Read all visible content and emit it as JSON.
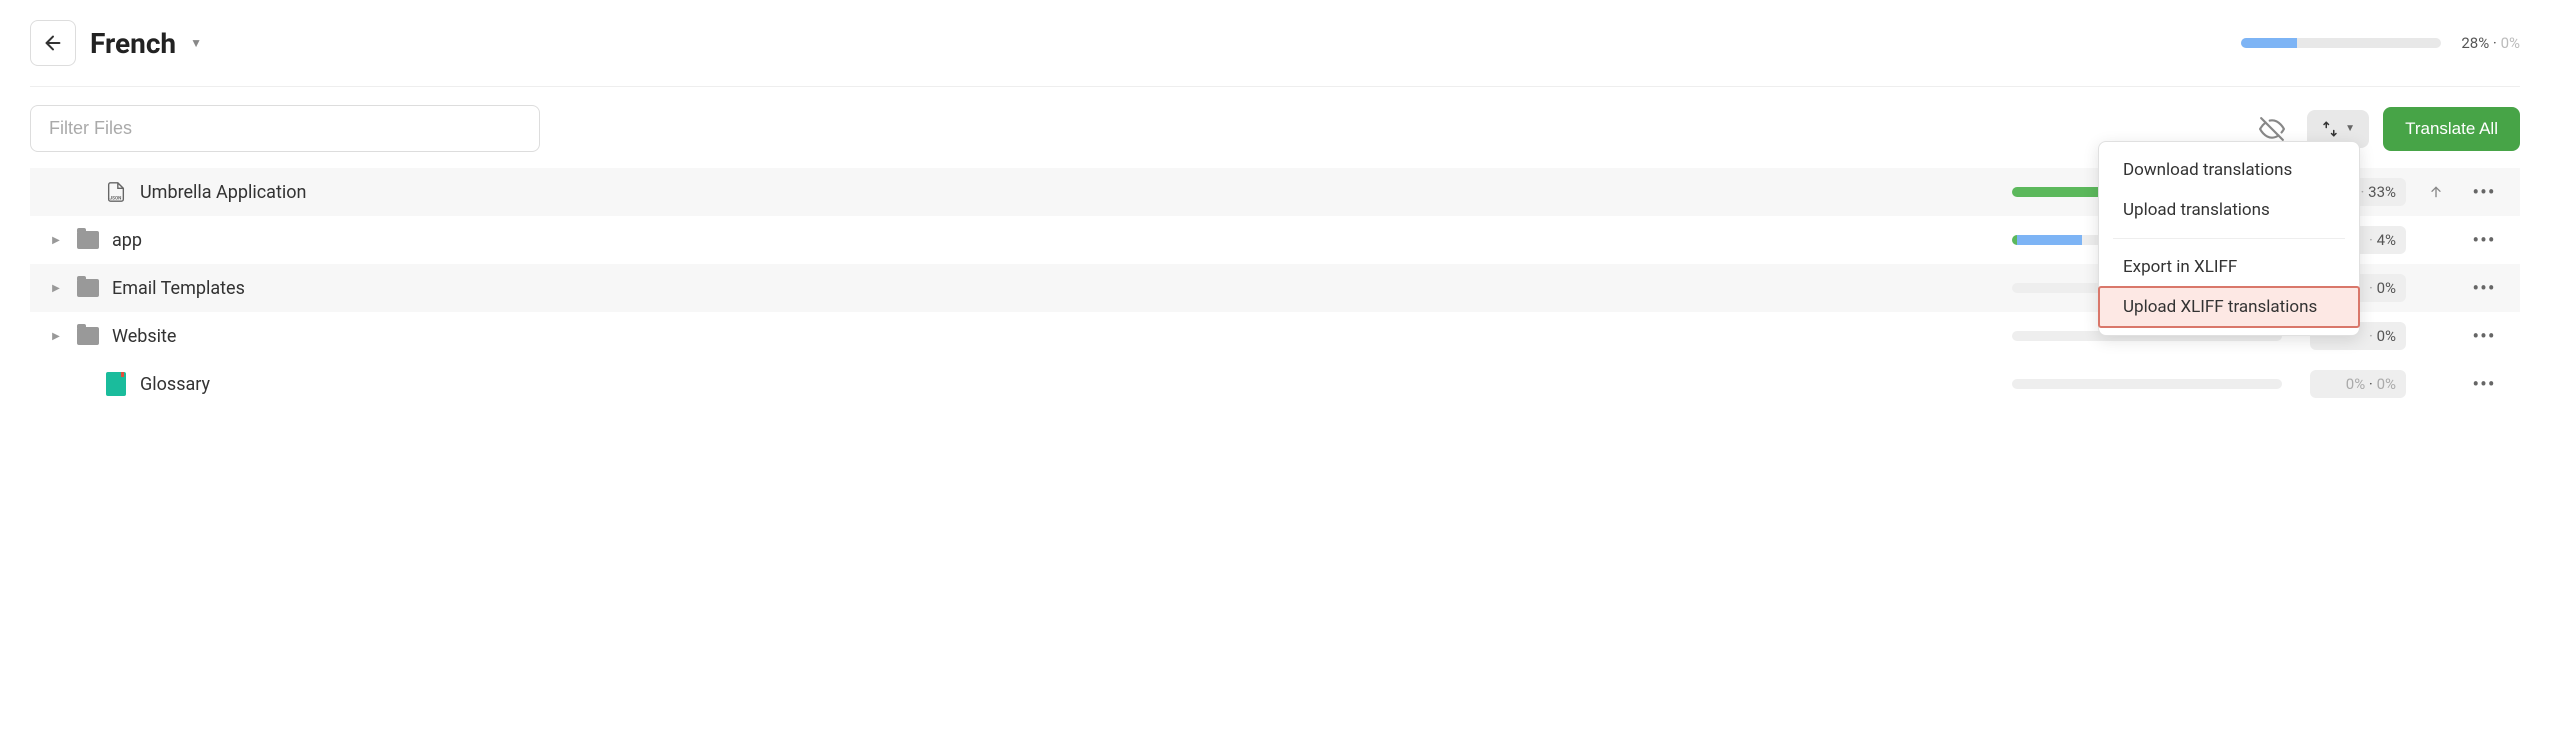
{
  "header": {
    "language": "French",
    "progress_pct": 28,
    "stats_primary": "28%",
    "stats_secondary": "0%"
  },
  "toolbar": {
    "filter_placeholder": "Filter Files",
    "translate_label": "Translate All"
  },
  "dropdown": {
    "items": [
      "Download translations",
      "Upload translations",
      "Export in XLIFF",
      "Upload XLIFF translations"
    ]
  },
  "files": [
    {
      "type": "json",
      "name": "Umbrella Application",
      "expandable": false,
      "green": 100,
      "blue": 0,
      "stat1": "33%",
      "stat2": "",
      "show_upload": true,
      "alt": true
    },
    {
      "type": "folder",
      "name": "app",
      "expandable": true,
      "green": 2,
      "blue": 24,
      "stat1": "4%",
      "stat2": "",
      "show_upload": false,
      "alt": false
    },
    {
      "type": "folder",
      "name": "Email Templates",
      "expandable": true,
      "green": 0,
      "blue": 0,
      "stat1": "0%",
      "stat2": "",
      "show_upload": false,
      "alt": true
    },
    {
      "type": "folder",
      "name": "Website",
      "expandable": true,
      "green": 0,
      "blue": 0,
      "stat1": "0%",
      "stat2": "",
      "show_upload": false,
      "alt": false
    },
    {
      "type": "glossary",
      "name": "Glossary",
      "expandable": false,
      "green": 0,
      "blue": 0,
      "stat1": "0%",
      "stat2": "0%",
      "show_upload": false,
      "alt": false
    }
  ]
}
